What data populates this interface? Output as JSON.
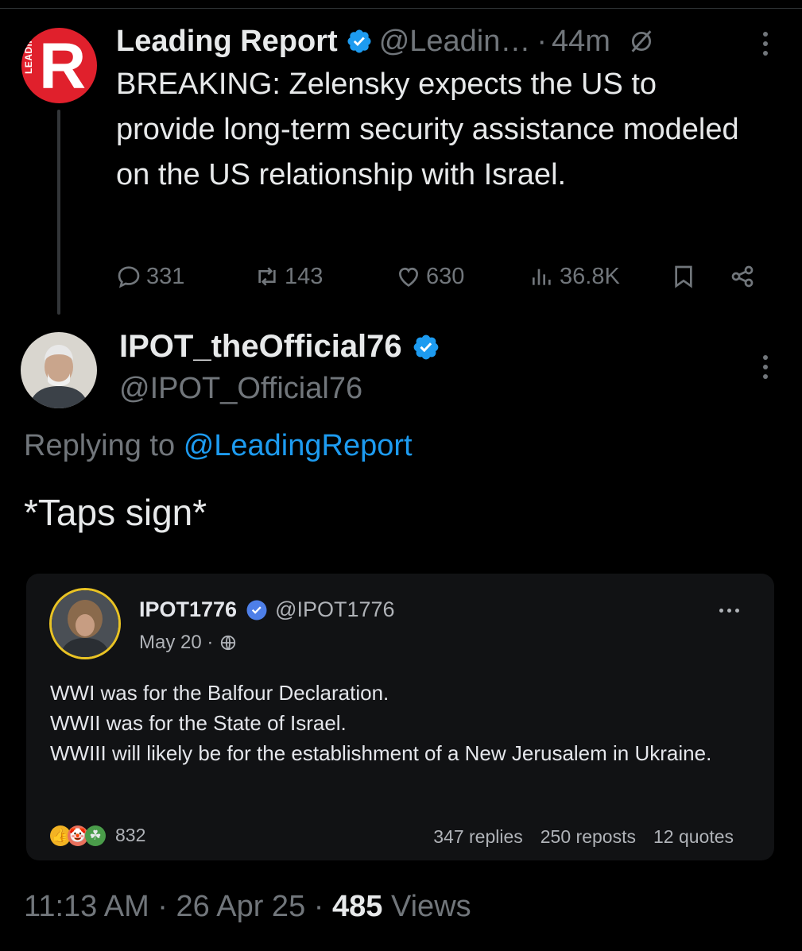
{
  "parent_tweet": {
    "avatar_text": "R",
    "avatar_side_text": "LEADING",
    "display_name": "Leading Report",
    "handle": "@Leadin…",
    "separator": "·",
    "time_ago": "44m",
    "text": "BREAKING: Zelensky expects the US to provide long-term security assistance modeled on the US relationship with Israel.",
    "actions": {
      "replies": "331",
      "reposts": "143",
      "likes": "630",
      "views": "36.8K"
    }
  },
  "reply": {
    "display_name": "IPOT_theOfficial76",
    "handle": "@IPOT_Official76",
    "replying_prefix": "Replying to",
    "replying_handle": "@LeadingReport",
    "text": "*Taps sign*"
  },
  "embedded_post": {
    "display_name": "IPOT1776",
    "handle": "@IPOT1776",
    "date": "May 20 ·",
    "lines": [
      "WWI was for the Balfour Declaration.",
      "WWII was for the State of Israel.",
      "WWIII will likely be for the establishment of a New Jerusalem in Ukraine."
    ],
    "reaction_count": "832",
    "replies": "347 replies",
    "reposts": "250 reposts",
    "quotes": "12 quotes"
  },
  "meta": {
    "time": "11:13 AM",
    "date": "26 Apr 25",
    "separator": "·",
    "views_count": "485",
    "views_label": "Views"
  },
  "colors": {
    "background": "#000000",
    "text": "#e7e9ea",
    "muted": "#71767b",
    "link": "#1d9bf0",
    "verified": "#1d9bf0",
    "leading_red": "#e0202c"
  },
  "icons": [
    "verified-badge-icon",
    "grok-icon",
    "more-vertical-icon",
    "reply-icon",
    "repost-icon",
    "like-icon",
    "views-icon",
    "bookmark-icon",
    "share-icon",
    "globe-icon",
    "more-horizontal-icon"
  ]
}
